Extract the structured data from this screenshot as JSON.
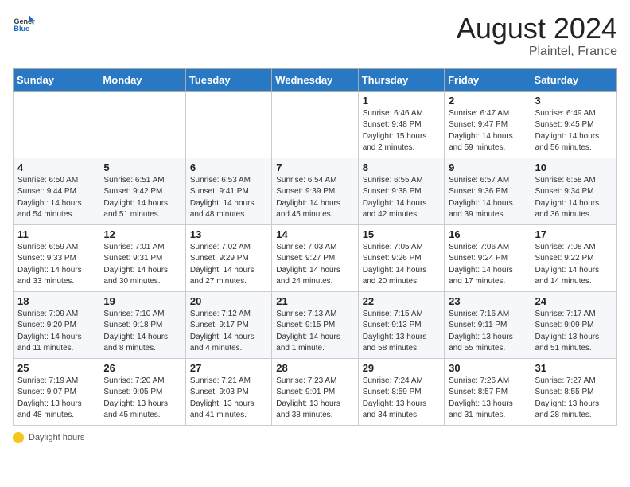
{
  "logo": {
    "general": "General",
    "blue": "Blue"
  },
  "title": "August 2024",
  "location": "Plaintel, France",
  "days_header": [
    "Sunday",
    "Monday",
    "Tuesday",
    "Wednesday",
    "Thursday",
    "Friday",
    "Saturday"
  ],
  "footer": {
    "label": "Daylight hours"
  },
  "weeks": [
    [
      {
        "day": "",
        "info": ""
      },
      {
        "day": "",
        "info": ""
      },
      {
        "day": "",
        "info": ""
      },
      {
        "day": "",
        "info": ""
      },
      {
        "day": "1",
        "info": "Sunrise: 6:46 AM\nSunset: 9:48 PM\nDaylight: 15 hours\nand 2 minutes."
      },
      {
        "day": "2",
        "info": "Sunrise: 6:47 AM\nSunset: 9:47 PM\nDaylight: 14 hours\nand 59 minutes."
      },
      {
        "day": "3",
        "info": "Sunrise: 6:49 AM\nSunset: 9:45 PM\nDaylight: 14 hours\nand 56 minutes."
      }
    ],
    [
      {
        "day": "4",
        "info": "Sunrise: 6:50 AM\nSunset: 9:44 PM\nDaylight: 14 hours\nand 54 minutes."
      },
      {
        "day": "5",
        "info": "Sunrise: 6:51 AM\nSunset: 9:42 PM\nDaylight: 14 hours\nand 51 minutes."
      },
      {
        "day": "6",
        "info": "Sunrise: 6:53 AM\nSunset: 9:41 PM\nDaylight: 14 hours\nand 48 minutes."
      },
      {
        "day": "7",
        "info": "Sunrise: 6:54 AM\nSunset: 9:39 PM\nDaylight: 14 hours\nand 45 minutes."
      },
      {
        "day": "8",
        "info": "Sunrise: 6:55 AM\nSunset: 9:38 PM\nDaylight: 14 hours\nand 42 minutes."
      },
      {
        "day": "9",
        "info": "Sunrise: 6:57 AM\nSunset: 9:36 PM\nDaylight: 14 hours\nand 39 minutes."
      },
      {
        "day": "10",
        "info": "Sunrise: 6:58 AM\nSunset: 9:34 PM\nDaylight: 14 hours\nand 36 minutes."
      }
    ],
    [
      {
        "day": "11",
        "info": "Sunrise: 6:59 AM\nSunset: 9:33 PM\nDaylight: 14 hours\nand 33 minutes."
      },
      {
        "day": "12",
        "info": "Sunrise: 7:01 AM\nSunset: 9:31 PM\nDaylight: 14 hours\nand 30 minutes."
      },
      {
        "day": "13",
        "info": "Sunrise: 7:02 AM\nSunset: 9:29 PM\nDaylight: 14 hours\nand 27 minutes."
      },
      {
        "day": "14",
        "info": "Sunrise: 7:03 AM\nSunset: 9:27 PM\nDaylight: 14 hours\nand 24 minutes."
      },
      {
        "day": "15",
        "info": "Sunrise: 7:05 AM\nSunset: 9:26 PM\nDaylight: 14 hours\nand 20 minutes."
      },
      {
        "day": "16",
        "info": "Sunrise: 7:06 AM\nSunset: 9:24 PM\nDaylight: 14 hours\nand 17 minutes."
      },
      {
        "day": "17",
        "info": "Sunrise: 7:08 AM\nSunset: 9:22 PM\nDaylight: 14 hours\nand 14 minutes."
      }
    ],
    [
      {
        "day": "18",
        "info": "Sunrise: 7:09 AM\nSunset: 9:20 PM\nDaylight: 14 hours\nand 11 minutes."
      },
      {
        "day": "19",
        "info": "Sunrise: 7:10 AM\nSunset: 9:18 PM\nDaylight: 14 hours\nand 8 minutes."
      },
      {
        "day": "20",
        "info": "Sunrise: 7:12 AM\nSunset: 9:17 PM\nDaylight: 14 hours\nand 4 minutes."
      },
      {
        "day": "21",
        "info": "Sunrise: 7:13 AM\nSunset: 9:15 PM\nDaylight: 14 hours\nand 1 minute."
      },
      {
        "day": "22",
        "info": "Sunrise: 7:15 AM\nSunset: 9:13 PM\nDaylight: 13 hours\nand 58 minutes."
      },
      {
        "day": "23",
        "info": "Sunrise: 7:16 AM\nSunset: 9:11 PM\nDaylight: 13 hours\nand 55 minutes."
      },
      {
        "day": "24",
        "info": "Sunrise: 7:17 AM\nSunset: 9:09 PM\nDaylight: 13 hours\nand 51 minutes."
      }
    ],
    [
      {
        "day": "25",
        "info": "Sunrise: 7:19 AM\nSunset: 9:07 PM\nDaylight: 13 hours\nand 48 minutes."
      },
      {
        "day": "26",
        "info": "Sunrise: 7:20 AM\nSunset: 9:05 PM\nDaylight: 13 hours\nand 45 minutes."
      },
      {
        "day": "27",
        "info": "Sunrise: 7:21 AM\nSunset: 9:03 PM\nDaylight: 13 hours\nand 41 minutes."
      },
      {
        "day": "28",
        "info": "Sunrise: 7:23 AM\nSunset: 9:01 PM\nDaylight: 13 hours\nand 38 minutes."
      },
      {
        "day": "29",
        "info": "Sunrise: 7:24 AM\nSunset: 8:59 PM\nDaylight: 13 hours\nand 34 minutes."
      },
      {
        "day": "30",
        "info": "Sunrise: 7:26 AM\nSunset: 8:57 PM\nDaylight: 13 hours\nand 31 minutes."
      },
      {
        "day": "31",
        "info": "Sunrise: 7:27 AM\nSunset: 8:55 PM\nDaylight: 13 hours\nand 28 minutes."
      }
    ]
  ]
}
